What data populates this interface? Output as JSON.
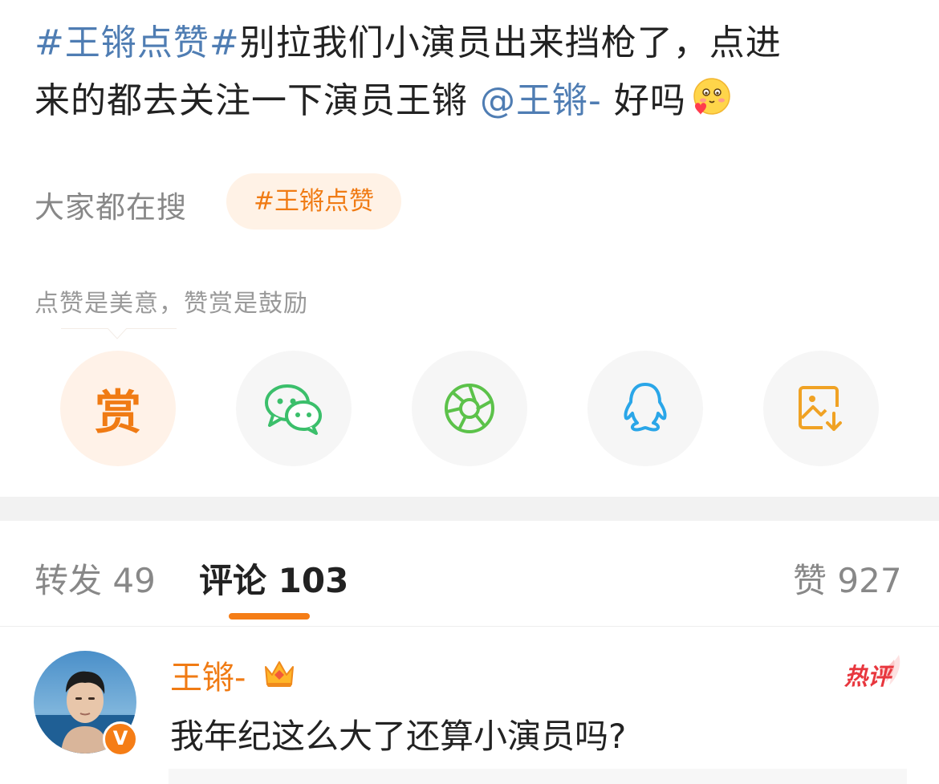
{
  "post": {
    "line1_tag": "#王锵点赞#",
    "line1_text": "别拉我们小演员出来挡枪了，点进",
    "line2_text": "来的都去关注一下演员王锵",
    "mention": "@王锵-",
    "line2_tail": "好吗",
    "emoji": "blushing-heart-emoji"
  },
  "search": {
    "label": "大家都在搜",
    "pill": "#王锵点赞"
  },
  "reward": {
    "caption": "点赞是美意，赞赏是鼓励",
    "button_char": "赏"
  },
  "share_icons": [
    "reward-button",
    "wechat-icon",
    "moments-icon",
    "qq-icon",
    "save-image-icon"
  ],
  "tabs": {
    "repost_label": "转发",
    "repost_count": "49",
    "comment_label": "评论",
    "comment_count": "103",
    "like_label": "赞",
    "like_count": "927"
  },
  "comment": {
    "author": "王锵-",
    "badge": "热评",
    "text": "我年纪这么大了还算小演员吗?",
    "verified": "V"
  },
  "colors": {
    "accent": "#f57d16",
    "link": "#4f7db3",
    "hot": "#e8373e"
  }
}
